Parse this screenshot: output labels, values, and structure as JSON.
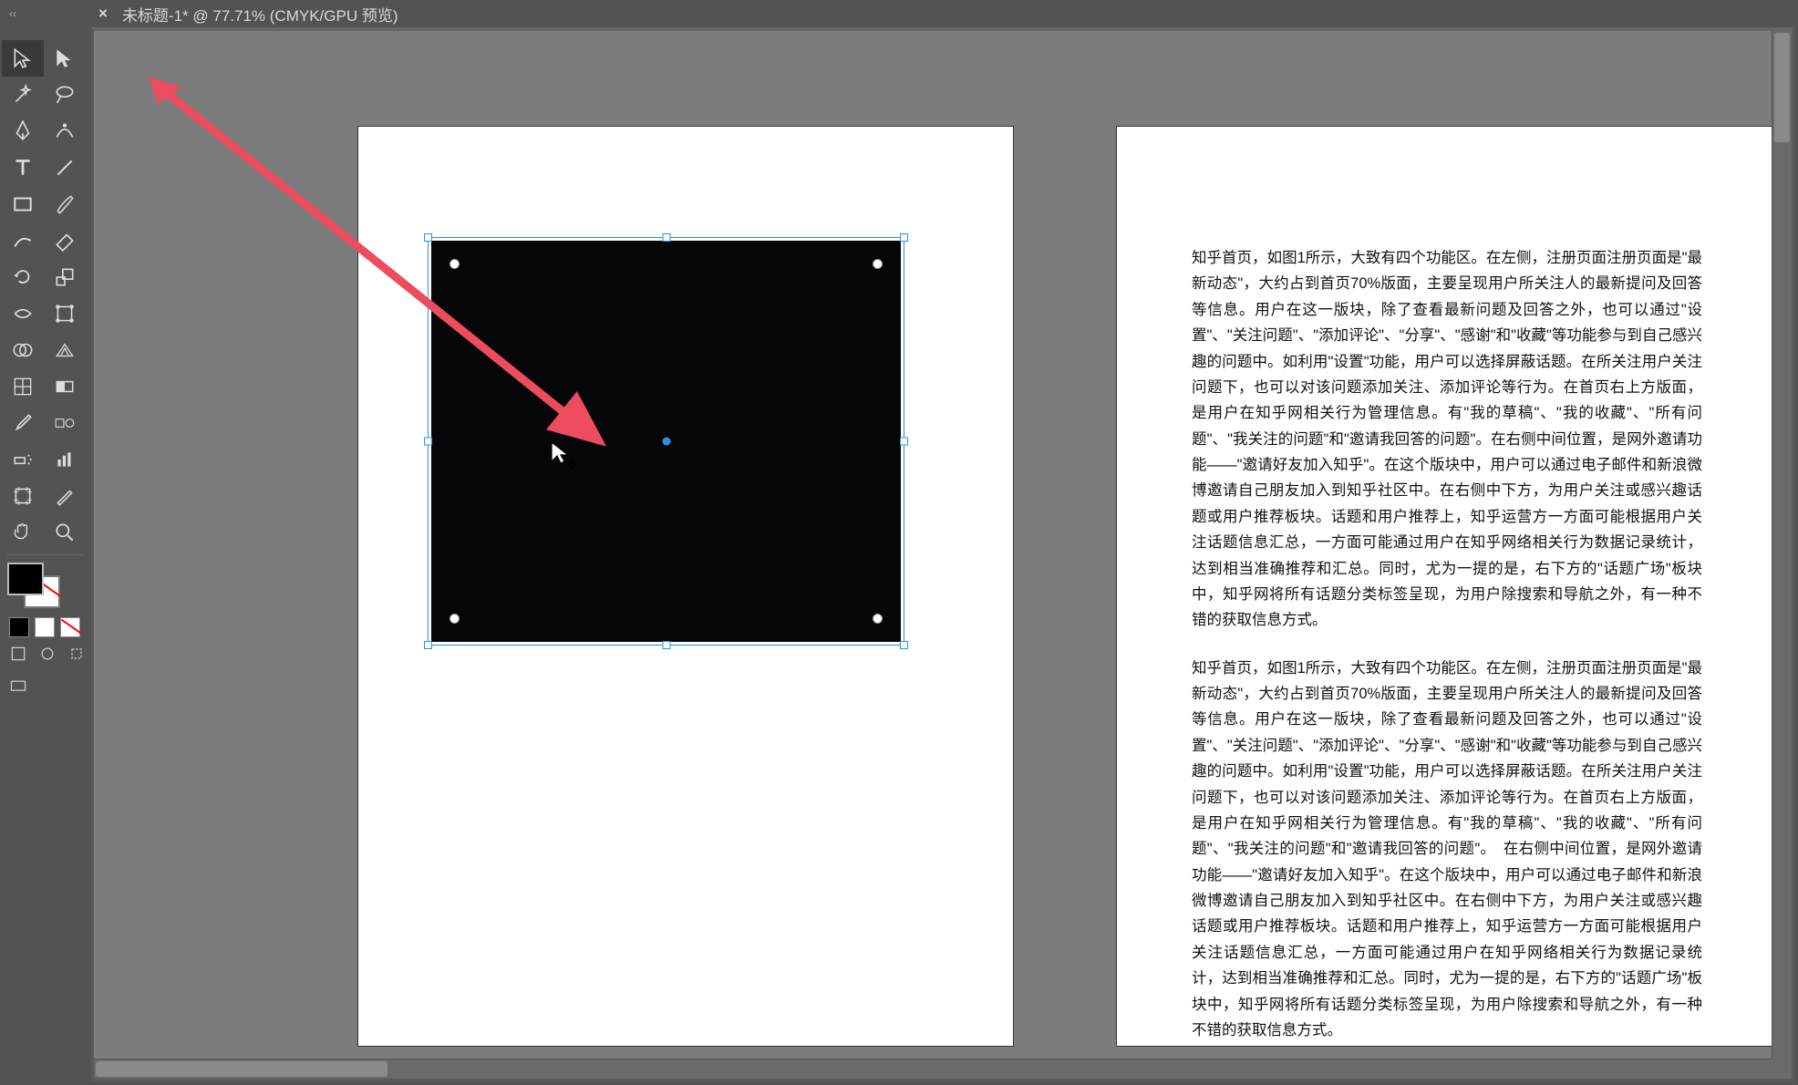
{
  "tab": {
    "close": "×",
    "title": "未标题-1* @ 77.71% (CMYK/GPU 预览)"
  },
  "tools": [
    {
      "name": "selection-tool",
      "interactable": true
    },
    {
      "name": "direct-selection-tool",
      "interactable": true
    },
    {
      "name": "magic-wand-tool",
      "interactable": true
    },
    {
      "name": "lasso-tool",
      "interactable": true
    },
    {
      "name": "pen-tool",
      "interactable": true
    },
    {
      "name": "curvature-tool",
      "interactable": true
    },
    {
      "name": "type-tool",
      "interactable": true
    },
    {
      "name": "line-segment-tool",
      "interactable": true
    },
    {
      "name": "rectangle-tool",
      "interactable": true
    },
    {
      "name": "paintbrush-tool",
      "interactable": true
    },
    {
      "name": "shaper-tool",
      "interactable": true
    },
    {
      "name": "eraser-tool",
      "interactable": true
    },
    {
      "name": "rotate-tool",
      "interactable": true
    },
    {
      "name": "scale-tool",
      "interactable": true
    },
    {
      "name": "width-tool",
      "interactable": true
    },
    {
      "name": "free-transform-tool",
      "interactable": true
    },
    {
      "name": "shape-builder-tool",
      "interactable": true
    },
    {
      "name": "perspective-grid-tool",
      "interactable": true
    },
    {
      "name": "mesh-tool",
      "interactable": true
    },
    {
      "name": "gradient-tool",
      "interactable": true
    },
    {
      "name": "eyedropper-tool",
      "interactable": true
    },
    {
      "name": "blend-tool",
      "interactable": true
    },
    {
      "name": "symbol-sprayer-tool",
      "interactable": true
    },
    {
      "name": "column-graph-tool",
      "interactable": true
    },
    {
      "name": "artboard-tool",
      "interactable": true
    },
    {
      "name": "slice-tool",
      "interactable": true
    },
    {
      "name": "hand-tool",
      "interactable": true
    },
    {
      "name": "zoom-tool",
      "interactable": true
    }
  ],
  "text_page": {
    "p1": "知乎首页，如图1所示，大致有四个功能区。在左侧，注册页面注册页面是\"最新动态\"，大约占到首页70%版面，主要呈现用户所关注人的最新提问及回答等信息。用户在这一版块，除了查看最新问题及回答之外，也可以通过\"设置\"、\"关注问题\"、\"添加评论\"、\"分享\"、\"感谢\"和\"收藏\"等功能参与到自己感兴趣的问题中。如利用\"设置\"功能，用户可以选择屏蔽话题。在所关注用户关注问题下，也可以对该问题添加关注、添加评论等行为。在首页右上方版面，是用户在知乎网相关行为管理信息。有\"我的草稿\"、\"我的收藏\"、\"所有问题\"、\"我关注的问题\"和\"邀请我回答的问题\"。在右侧中间位置，是网外邀请功能——\"邀请好友加入知乎\"。在这个版块中，用户可以通过电子邮件和新浪微博邀请自己朋友加入到知乎社区中。在右侧中下方，为用户关注或感兴趣话题或用户推荐板块。话题和用户推荐上，知乎运营方一方面可能根据用户关注话题信息汇总，一方面可能通过用户在知乎网络相关行为数据记录统计，达到相当准确推荐和汇总。同时，尤为一提的是，右下方的\"话题广场\"板块中，知乎网将所有话题分类标签呈现，为用户除搜索和导航之外，有一种不错的获取信息方式。",
    "p2": "知乎首页，如图1所示，大致有四个功能区。在左侧，注册页面注册页面是\"最新动态\"，大约占到首页70%版面，主要呈现用户所关注人的最新提问及回答等信息。用户在这一版块，除了查看最新问题及回答之外，也可以通过\"设置\"、\"关注问题\"、\"添加评论\"、\"分享\"、\"感谢\"和\"收藏\"等功能参与到自己感兴趣的问题中。如利用\"设置\"功能，用户可以选择屏蔽话题。在所关注用户关注问题下，也可以对该问题添加关注、添加评论等行为。在首页右上方版面，是用户在知乎网相关行为管理信息。有\"我的草稿\"、\"我的收藏\"、\"所有问题\"、\"我关注的问题\"和\"邀请我回答的问题\"。　在右侧中间位置，是网外邀请功能——\"邀请好友加入知乎\"。在这个版块中，用户可以通过电子邮件和新浪微博邀请自己朋友加入到知乎社区中。在右侧中下方，为用户关注或感兴趣话题或用户推荐板块。话题和用户推荐上，知乎运营方一方面可能根据用户关注话题信息汇总，一方面可能通过用户在知乎网络相关行为数据记录统计，达到相当准确推荐和汇总。同时，尤为一提的是，右下方的\"话题广场\"板块中，知乎网将所有话题分类标签呈现，为用户除搜索和导航之外，有一种不错的获取信息方式。"
  },
  "colors": {
    "selection": "#2393e6",
    "annotation_arrow": "#ef4b5f",
    "shape_fill": "#060609"
  }
}
